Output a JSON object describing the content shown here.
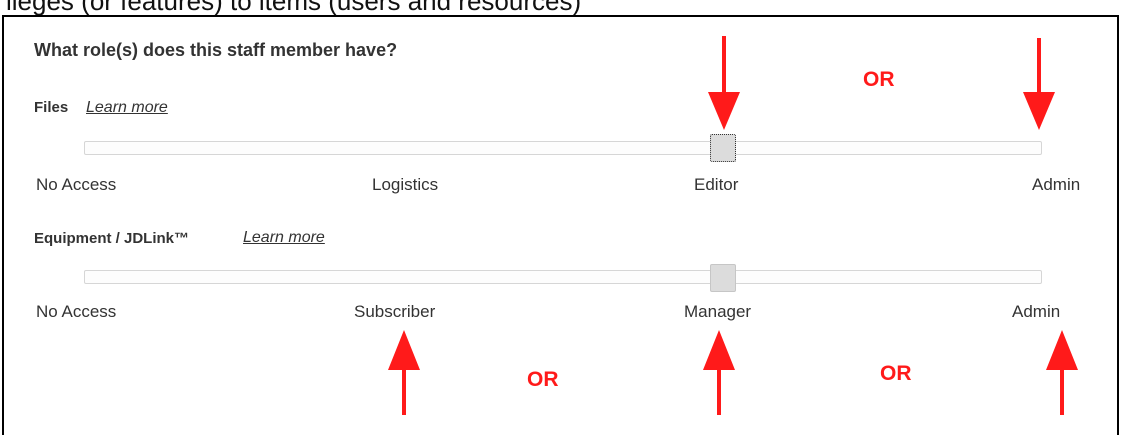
{
  "top_fragment": "ileges (or features) to items (users and resources)",
  "question": "What role(s) does this staff member have?",
  "sections": [
    {
      "label": "Files",
      "learn_more": "Learn more",
      "options": [
        "No Access",
        "Logistics",
        "Editor",
        "Admin"
      ],
      "selected": "Editor"
    },
    {
      "label": "Equipment / JDLink™",
      "learn_more": "Learn more",
      "options": [
        "No Access",
        "Subscriber",
        "Manager",
        "Admin"
      ],
      "selected": "Manager"
    }
  ],
  "annotations": {
    "or_labels": [
      "OR",
      "OR",
      "OR"
    ],
    "color": "#ff1a1a"
  }
}
